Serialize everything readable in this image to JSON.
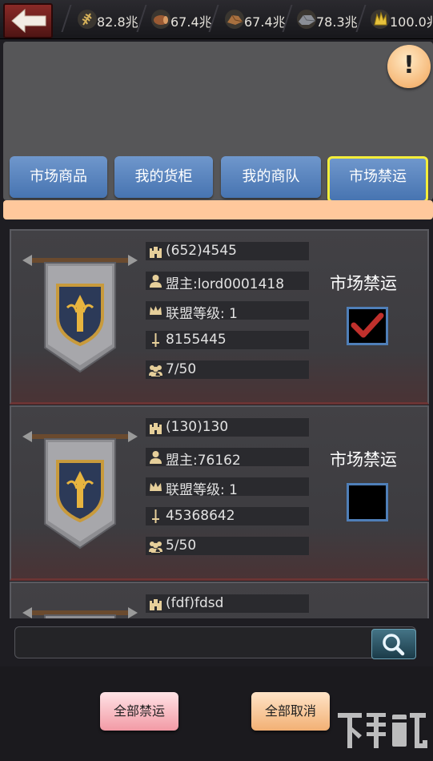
{
  "top_bar": {
    "resources": [
      {
        "icon": "wheat-icon",
        "value": "82.8兆"
      },
      {
        "icon": "wood-icon",
        "value": "67.4兆"
      },
      {
        "icon": "stone-icon",
        "value": "67.4兆"
      },
      {
        "icon": "iron-ore-icon",
        "value": "78.3兆"
      },
      {
        "icon": "gold-icon",
        "value": "100.0兆"
      }
    ]
  },
  "info_button": {
    "label": "!"
  },
  "tabs": [
    {
      "label": "市场商品",
      "active": false
    },
    {
      "label": "我的货柜",
      "active": false
    },
    {
      "label": "我的商队",
      "active": false
    },
    {
      "label": "市场禁运",
      "active": true
    }
  ],
  "alliances": [
    {
      "name": "(652)4545",
      "leader": "盟主:lord0001418",
      "level": "联盟等级: 1",
      "power": "8155445",
      "members": "7/50",
      "embargo_label": "市场禁运",
      "embargoed": true
    },
    {
      "name": "(130)130",
      "leader": "盟主:76162",
      "level": "联盟等级: 1",
      "power": "45368642",
      "members": "5/50",
      "embargo_label": "市场禁运",
      "embargoed": false
    },
    {
      "name": "(fdf)fdsd"
    }
  ],
  "search": {
    "value": "",
    "placeholder": ""
  },
  "actions": {
    "embargo_all": "全部禁运",
    "cancel_all": "全部取消"
  },
  "colors": {
    "tab_blue": "#4f7fc0",
    "active_border": "#f4ee3a",
    "checkmark": "#c0302c",
    "accent_strip": "#ffc89c"
  }
}
